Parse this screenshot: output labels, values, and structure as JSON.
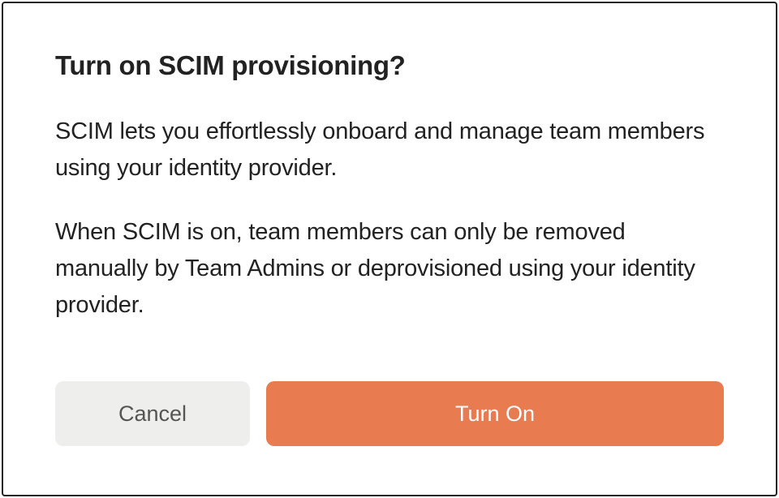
{
  "dialog": {
    "title": "Turn on SCIM provisioning?",
    "paragraph1": "SCIM lets you effortlessly onboard and manage team members using your identity provider.",
    "paragraph2": "When SCIM is on, team members can only be removed manually by Team Admins or deprovisioned using your identity provider.",
    "cancel_label": "Cancel",
    "confirm_label": "Turn On"
  }
}
